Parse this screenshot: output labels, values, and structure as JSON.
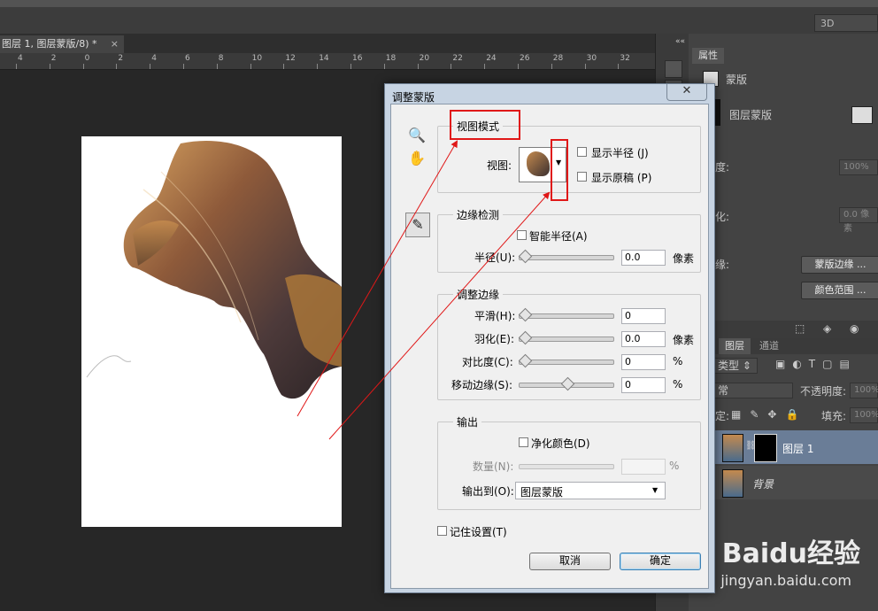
{
  "workspace": {
    "selector": "3D"
  },
  "document_tab": {
    "title": "图层 1, 图层蒙版/8) *",
    "close": "×"
  },
  "ruler": {
    "ticks": [
      "4",
      "2",
      "0",
      "2",
      "4",
      "6",
      "8",
      "10",
      "12",
      "14",
      "16",
      "18",
      "20",
      "22",
      "24",
      "26",
      "28",
      "30",
      "32"
    ]
  },
  "panel_strip": {
    "collapse": "««"
  },
  "properties": {
    "tab": "属性",
    "mask_label": "蒙版",
    "layer_mask_label": "图层蒙版",
    "density_label": "度:",
    "density_value": "100%",
    "feather_label": "化:",
    "feather_value": "0.0 像素",
    "refine_label": "缘:",
    "mask_edge_button": "蒙版边缘 ...",
    "color_range_button": "颜色范围 ..."
  },
  "layers": {
    "tabs": [
      "图层",
      "通道"
    ],
    "kind_filter": "类型",
    "blend_mode": "常",
    "opacity_label": "不透明度:",
    "opacity_value": "100%",
    "lock_label": "定:",
    "fill_label": "填充:",
    "fill_value": "100%",
    "rows": [
      {
        "name": "图层 1",
        "selected": true
      },
      {
        "name": "背景",
        "selected": false
      }
    ]
  },
  "dialog": {
    "title": "调整蒙版",
    "close": "✕",
    "view_mode": {
      "title": "视图模式",
      "view_label": "视图:",
      "show_radius": "显示半径 (J)",
      "show_original": "显示原稿 (P)"
    },
    "edge_detection": {
      "title": "边缘检测",
      "smart_radius": "智能半径(A)",
      "radius_label": "半径(U):",
      "radius_value": "0.0",
      "radius_unit": "像素",
      "radius_level": 0
    },
    "adjust_edge": {
      "title": "调整边缘",
      "rows": [
        {
          "label": "平滑(H):",
          "value": "0",
          "unit": "",
          "level": 0
        },
        {
          "label": "羽化(E):",
          "value": "0.0",
          "unit": "像素",
          "level": 0
        },
        {
          "label": "对比度(C):",
          "value": "0",
          "unit": "%",
          "level": 0
        },
        {
          "label": "移动边缘(S):",
          "value": "0",
          "unit": "%",
          "level": 0.5
        }
      ]
    },
    "output": {
      "title": "输出",
      "decontaminate": "净化颜色(D)",
      "amount_label": "数量(N):",
      "amount_unit": "%",
      "output_to_label": "输出到(O):",
      "output_to_value": "图层蒙版"
    },
    "remember": "记住设置(T)",
    "cancel": "取消",
    "ok": "确定"
  },
  "watermark": {
    "brand": "Baidu经验",
    "url": "jingyan.baidu.com"
  },
  "colors": {
    "annotation_red": "#e01818",
    "selected_layer": "#6a7d97",
    "dialog_frame": "#c7d4e3"
  }
}
